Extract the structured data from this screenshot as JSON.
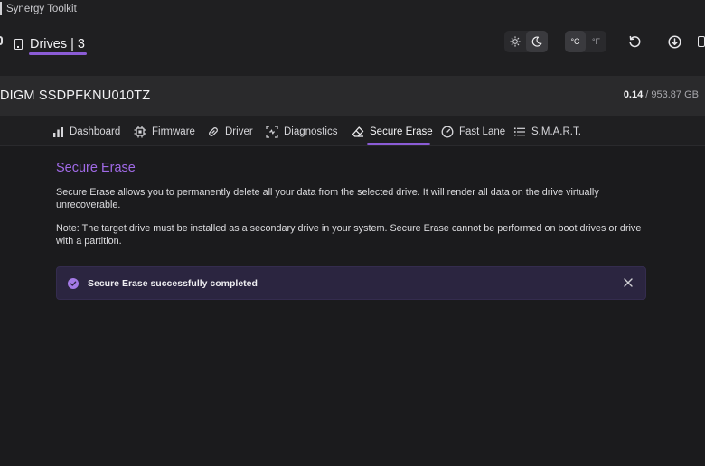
{
  "app": {
    "title": "Synergy Toolkit"
  },
  "nav": {
    "drives_label": "Drives",
    "separator": "|",
    "drives_count": "3"
  },
  "header_controls": {
    "theme": {
      "light_icon": "sun-icon",
      "dark_icon": "moon-icon",
      "selected": "dark"
    },
    "units": {
      "celsius": "°C",
      "fahrenheit": "°F",
      "selected": "celsius"
    },
    "refresh_icon": "refresh-icon",
    "download_icon": "download-icon"
  },
  "drive": {
    "name": "DIGM SSDPFKNU010TZ",
    "used": "0.14",
    "capacity": " / 953.87 GB"
  },
  "tabs": [
    {
      "label": "Dashboard",
      "icon": "dashboard-icon"
    },
    {
      "label": "Firmware",
      "icon": "chip-icon"
    },
    {
      "label": "Driver",
      "icon": "link-icon"
    },
    {
      "label": "Diagnostics",
      "icon": "diagnostics-icon"
    },
    {
      "label": "Secure Erase",
      "icon": "eraser-icon"
    },
    {
      "label": "Fast Lane",
      "icon": "gauge-icon"
    },
    {
      "label": "S.M.A.R.T.",
      "icon": "list-icon"
    }
  ],
  "active_tab": "Secure Erase",
  "secure_erase": {
    "title": "Secure Erase",
    "description": "Secure Erase allows you to permanently delete all your data from the selected drive. It will render all data on the drive virtually unrecoverable.",
    "note": "Note: The target drive must be installed as a secondary drive in your system. Secure Erase cannot be performed on boot drives or drive with a partition."
  },
  "alert": {
    "message": "Secure Erase successfully completed"
  },
  "colors": {
    "accent": "#8b5cd6",
    "title": "#a06ae6",
    "alert_bg": "#2b2540",
    "background": "#1b1b1d"
  }
}
